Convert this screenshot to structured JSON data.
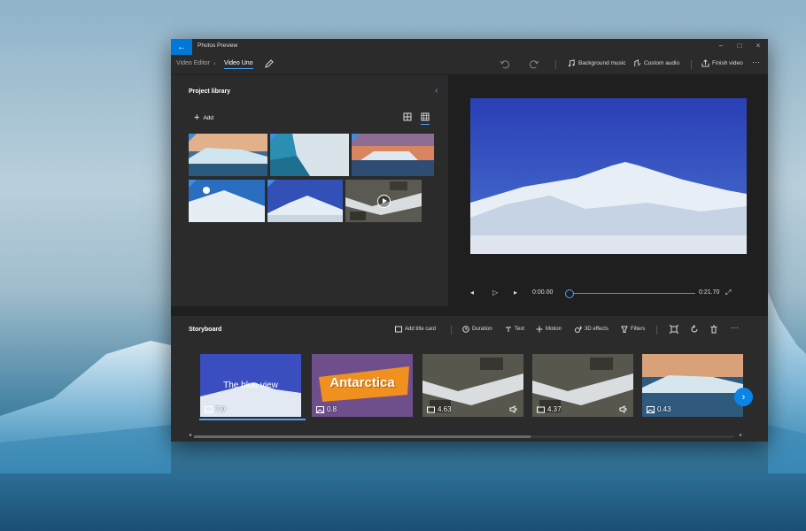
{
  "window": {
    "app_title": "Photos Preview",
    "back_icon": "back-arrow-icon",
    "controls": [
      "–",
      "□",
      "×"
    ]
  },
  "breadcrumb": {
    "root": "Video Editor",
    "separator": "›",
    "current": "Video Uno"
  },
  "toolbar": {
    "background_music": "Background music",
    "custom_audio": "Custom audio",
    "finish_video": "Finish video",
    "more": "···"
  },
  "library": {
    "title": "Project library",
    "add_label": "Add",
    "collapse_icon": "chevron-left-icon",
    "thumbnails": [
      {
        "name": "iceberg-reflection",
        "video": false
      },
      {
        "name": "ice-wall-closeup",
        "video": false
      },
      {
        "name": "iceberg-sunset",
        "video": false
      },
      {
        "name": "snow-slope-sun",
        "video": false
      },
      {
        "name": "mountain-snow",
        "video": false
      },
      {
        "name": "stream-rocks",
        "video": true
      }
    ]
  },
  "preview": {
    "current_time": "0:00.00",
    "total_time": "0:21.70",
    "progress": 0
  },
  "storyboard": {
    "title": "Storyboard",
    "tools": {
      "add_title_card": "Add title card",
      "duration": "Duration",
      "text": "Text",
      "motion": "Motion",
      "effects": "3D effects",
      "filters": "Filters"
    },
    "clips": [
      {
        "type": "image",
        "duration": "7.0",
        "overlay": "The blue view",
        "selected": true,
        "audio": false
      },
      {
        "type": "image",
        "duration": "0.8",
        "overlay": "Antarctica",
        "selected": false,
        "audio": false
      },
      {
        "type": "video",
        "duration": "4.63",
        "overlay": "",
        "selected": false,
        "audio": true
      },
      {
        "type": "video",
        "duration": "4.37",
        "overlay": "",
        "selected": false,
        "audio": true
      },
      {
        "type": "image",
        "duration": "0.43",
        "overlay": "",
        "selected": false,
        "audio": false
      }
    ]
  },
  "colors": {
    "accent": "#0078d7",
    "panel": "#2b2b2b",
    "window_bg": "#1f1f1f"
  }
}
